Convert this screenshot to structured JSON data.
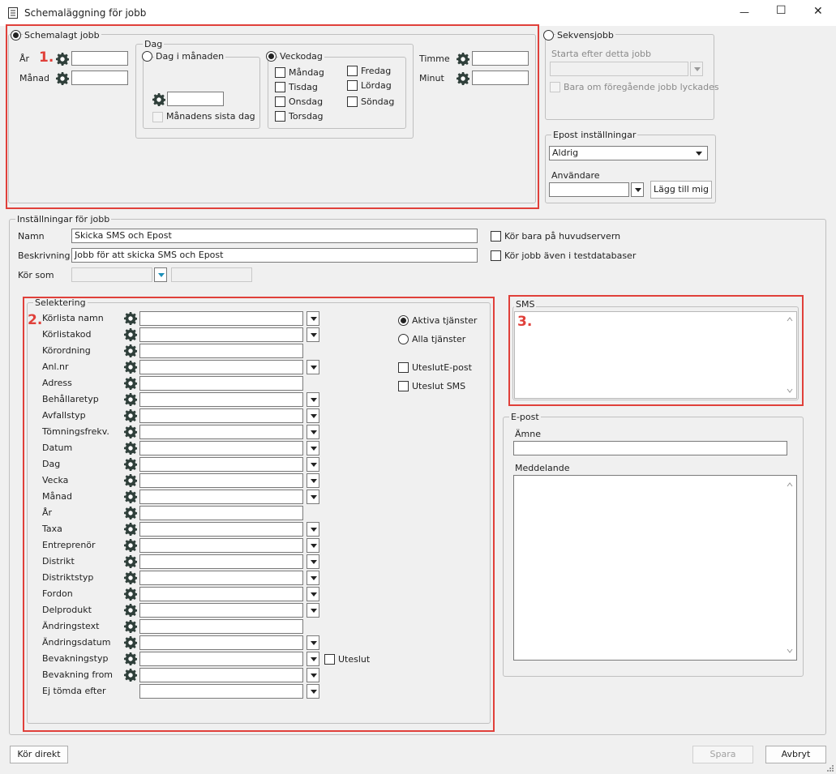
{
  "window": {
    "title": "Schemaläggning för jobb",
    "controls": {
      "minimize": "—",
      "maximize": "☐",
      "close": "✕"
    }
  },
  "schedule": {
    "radio_label": "Schemalagt jobb",
    "year_label": "År",
    "month_label": "Månad",
    "hour_label": "Timme",
    "minute_label": "Minut",
    "day": {
      "group_label": "Dag",
      "day_of_month_label": "Dag i månaden",
      "last_day_label": "Månadens sista dag",
      "weekday_label": "Veckodag",
      "weekdays": [
        "Måndag",
        "Tisdag",
        "Onsdag",
        "Torsdag",
        "Fredag",
        "Lördag",
        "Söndag"
      ]
    }
  },
  "sequence": {
    "radio_label": "Sekvensjobb",
    "start_after_label": "Starta efter detta jobb",
    "only_if_success_label": "Bara om föregående jobb lyckades"
  },
  "email_settings": {
    "group_label": "Epost inställningar",
    "frequency_value": "Aldrig",
    "users_label": "Användare",
    "add_me_label": "Lägg till mig"
  },
  "job_settings": {
    "group_label": "Inställningar för jobb",
    "name_label": "Namn",
    "name_value": "Skicka SMS och Epost",
    "description_label": "Beskrivning",
    "description_value": "Jobb för att skicka SMS och Epost",
    "run_as_label": "Kör som",
    "main_server_only_label": "Kör bara på huvudservern",
    "also_test_db_label": "Kör jobb även i testdatabaser"
  },
  "selection": {
    "group_label": "Selektering",
    "fields": [
      {
        "label": "Körlista namn",
        "type": "combo",
        "gear": true
      },
      {
        "label": "Körlistakod",
        "type": "combo",
        "gear": true
      },
      {
        "label": "Körordning",
        "type": "text",
        "gear": true
      },
      {
        "label": "Anl.nr",
        "type": "combo",
        "gear": true
      },
      {
        "label": "Adress",
        "type": "text",
        "gear": true
      },
      {
        "label": "Behållaretyp",
        "type": "combo",
        "gear": true
      },
      {
        "label": "Avfallstyp",
        "type": "combo",
        "gear": true
      },
      {
        "label": "Tömningsfrekv.",
        "type": "combo",
        "gear": true
      },
      {
        "label": "Datum",
        "type": "combo",
        "gear": true
      },
      {
        "label": "Dag",
        "type": "combo",
        "gear": true
      },
      {
        "label": "Vecka",
        "type": "combo",
        "gear": true
      },
      {
        "label": "Månad",
        "type": "combo",
        "gear": true
      },
      {
        "label": "År",
        "type": "text",
        "gear": true
      },
      {
        "label": "Taxa",
        "type": "combo",
        "gear": true
      },
      {
        "label": "Entreprenör",
        "type": "combo",
        "gear": true
      },
      {
        "label": "Distrikt",
        "type": "combo",
        "gear": true
      },
      {
        "label": "Distriktstyp",
        "type": "combo",
        "gear": true
      },
      {
        "label": "Fordon",
        "type": "combo",
        "gear": true
      },
      {
        "label": "Delprodukt",
        "type": "combo",
        "gear": true
      },
      {
        "label": "Ändringstext",
        "type": "text",
        "gear": true
      },
      {
        "label": "Ändringsdatum",
        "type": "combo",
        "gear": true
      },
      {
        "label": "Bevakningstyp",
        "type": "combo",
        "gear": true
      },
      {
        "label": "Bevakning from",
        "type": "combo",
        "gear": true
      },
      {
        "label": "Ej tömda efter",
        "type": "combo",
        "gear": false
      }
    ],
    "active_services_label": "Aktiva tjänster",
    "all_services_label": "Alla tjänster",
    "exclude_email_label": "UteslutE-post",
    "exclude_sms_label": "Uteslut SMS",
    "exclude_label": "Uteslut"
  },
  "sms": {
    "group_label": "SMS"
  },
  "email": {
    "group_label": "E-post",
    "subject_label": "Ämne",
    "message_label": "Meddelande"
  },
  "buttons": {
    "run_now": "Kör direkt",
    "save": "Spara",
    "cancel": "Avbryt"
  },
  "annotations": {
    "one": "1.",
    "two": "2.",
    "three": "3."
  },
  "colors": {
    "highlight": "#e0403a",
    "window_bg": "#f0f0f0"
  },
  "icons": {
    "gear": "gear-icon",
    "title": "document-icon"
  }
}
